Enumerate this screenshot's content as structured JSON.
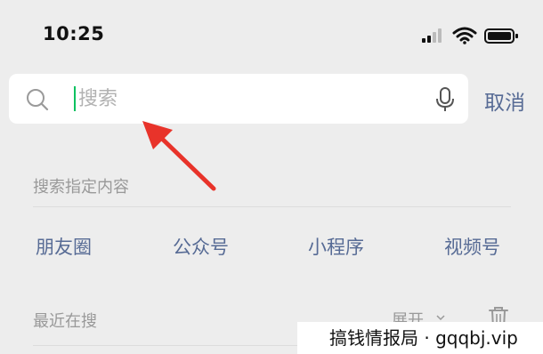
{
  "status_bar": {
    "time": "10:25",
    "icons": [
      "cellular-signal-icon",
      "wifi-icon",
      "battery-icon"
    ]
  },
  "search": {
    "placeholder": "搜索",
    "value": "",
    "cancel_label": "取消",
    "icons": [
      "search-icon",
      "microphone-icon"
    ]
  },
  "specified_search": {
    "title": "搜索指定内容",
    "shortcuts": [
      "朋友圈",
      "公众号",
      "小程序",
      "视频号"
    ]
  },
  "recent": {
    "title": "最近在搜",
    "expand_label": "展开",
    "icons": [
      "chevron-down-icon",
      "trash-icon"
    ]
  },
  "watermark": "搞钱情报局 · gqqbj.vip",
  "colors": {
    "background": "#ededed",
    "link": "#576b95",
    "muted": "#999999",
    "annotation_arrow": "#e8332a",
    "cursor": "#07c160"
  }
}
